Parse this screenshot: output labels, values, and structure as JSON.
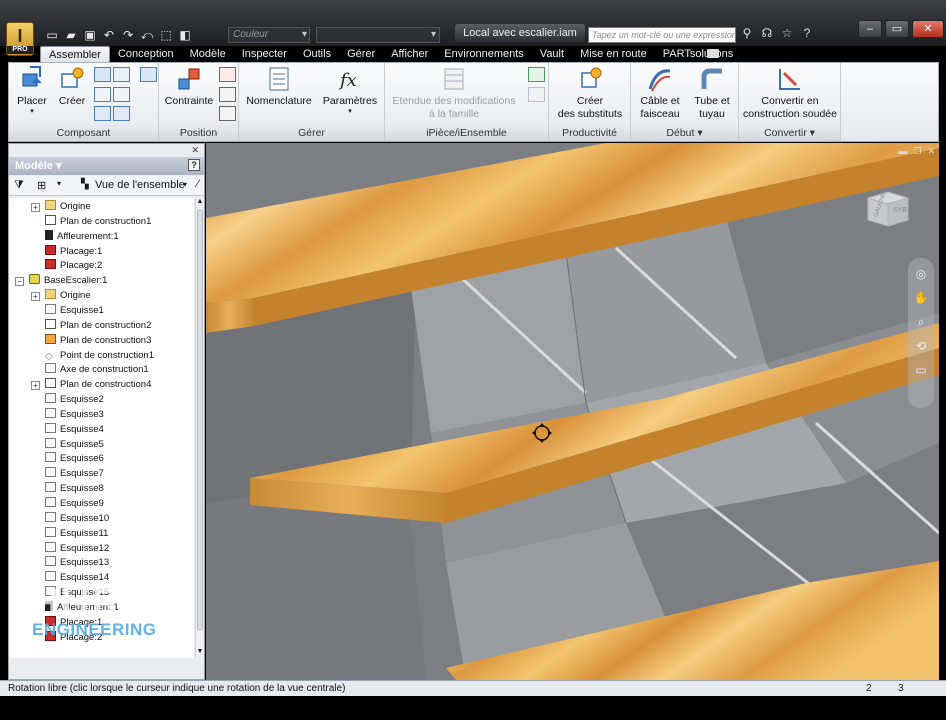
{
  "titlebar": {
    "app_letter": "I",
    "app_badge": "PRO",
    "color_placeholder": "Couleur",
    "document_title": "Local avec escalier.iam",
    "search_placeholder": "Tapez un mot-clé ou une expression"
  },
  "tabs": [
    "Assembler",
    "Conception",
    "Modèle",
    "Inspecter",
    "Outils",
    "Gérer",
    "Afficher",
    "Environnements",
    "Vault",
    "Mise en route",
    "PARTsolutions"
  ],
  "ribbon": {
    "panels": {
      "composant": "Composant",
      "position": "Position",
      "gerer": "Gérer",
      "ipiece": "iPièce/iEnsemble",
      "productivite": "Productivité",
      "debut": "Début ▾",
      "convertir": "Convertir ▾"
    },
    "buttons": {
      "placer": "Placer",
      "creer": "Créer",
      "contrainte": "Contrainte",
      "nomenclature": "Nomenclature",
      "parametres": "Paramètres",
      "etendue_1": "Etendue des modifications",
      "etendue_2": "à la famille",
      "substituts_1": "Créer",
      "substituts_2": "des substituts",
      "cable_1": "Câble et",
      "cable_2": "faisceau",
      "tube_1": "Tube et",
      "tube_2": "tuyau",
      "convertir_1": "Convertir en",
      "convertir_2": "construction soudée"
    }
  },
  "browser": {
    "title": "Modèle ▾",
    "help": "?",
    "view_label": "Vue de l'ensemble",
    "tree": [
      {
        "label": "Origine",
        "icon": "folder",
        "indent": 2,
        "expander": "+"
      },
      {
        "label": "Plan de construction1",
        "icon": "plane",
        "indent": 2
      },
      {
        "label": "Affleurement:1",
        "icon": "flush",
        "indent": 2
      },
      {
        "label": "Placage:1",
        "icon": "place",
        "indent": 2
      },
      {
        "label": "Placage:2",
        "icon": "place",
        "indent": 2
      },
      {
        "label": "BaseEscalier:1",
        "icon": "base",
        "indent": 1,
        "expander": "−"
      },
      {
        "label": "Origine",
        "icon": "folder",
        "indent": 2,
        "expander": "+"
      },
      {
        "label": "Esquisse1",
        "icon": "sketch",
        "indent": 2
      },
      {
        "label": "Plan de construction2",
        "icon": "plane",
        "indent": 2
      },
      {
        "label": "Plan de construction3",
        "icon": "plane2",
        "indent": 2
      },
      {
        "label": "Point de construction1",
        "icon": "point",
        "indent": 2
      },
      {
        "label": "Axe de construction1",
        "icon": "axis",
        "indent": 2
      },
      {
        "label": "Plan de construction4",
        "icon": "plane",
        "indent": 2,
        "expander": "+"
      },
      {
        "label": "Esquisse2",
        "icon": "sketch",
        "indent": 2
      },
      {
        "label": "Esquisse3",
        "icon": "sketch",
        "indent": 2
      },
      {
        "label": "Esquisse4",
        "icon": "sketch",
        "indent": 2
      },
      {
        "label": "Esquisse5",
        "icon": "sketch",
        "indent": 2
      },
      {
        "label": "Esquisse6",
        "icon": "sketch",
        "indent": 2
      },
      {
        "label": "Esquisse7",
        "icon": "sketch",
        "indent": 2
      },
      {
        "label": "Esquisse8",
        "icon": "sketch",
        "indent": 2
      },
      {
        "label": "Esquisse9",
        "icon": "sketch",
        "indent": 2
      },
      {
        "label": "Esquisse10",
        "icon": "sketch",
        "indent": 2
      },
      {
        "label": "Esquisse11",
        "icon": "sketch",
        "indent": 2
      },
      {
        "label": "Esquisse12",
        "icon": "sketch",
        "indent": 2
      },
      {
        "label": "Esquisse13",
        "icon": "sketch",
        "indent": 2
      },
      {
        "label": "Esquisse14",
        "icon": "sketch",
        "indent": 2
      },
      {
        "label": "Esquisse15",
        "icon": "sketch",
        "indent": 2
      },
      {
        "label": "Affleurement:1",
        "icon": "flush",
        "indent": 2
      },
      {
        "label": "Placage:1",
        "icon": "place",
        "indent": 2
      },
      {
        "label": "Placage:2",
        "icon": "place",
        "indent": 2
      }
    ]
  },
  "watermark": {
    "line1": "HURN",
    "line2": "ENGINEERING"
  },
  "viewport": {
    "viewcube_face": "GAUCHE",
    "viewcube_side": "SYB"
  },
  "status": {
    "message": "Rotation libre (clic lorsque le curseur indique une rotation de la vue centrale)",
    "count1": "2",
    "count2": "3"
  },
  "colors": {
    "wood_light": "#f2c46e",
    "wood_dark": "#d08a2a",
    "stringer_gray": "#9ea1a5",
    "background_gray": "#7d8084"
  }
}
